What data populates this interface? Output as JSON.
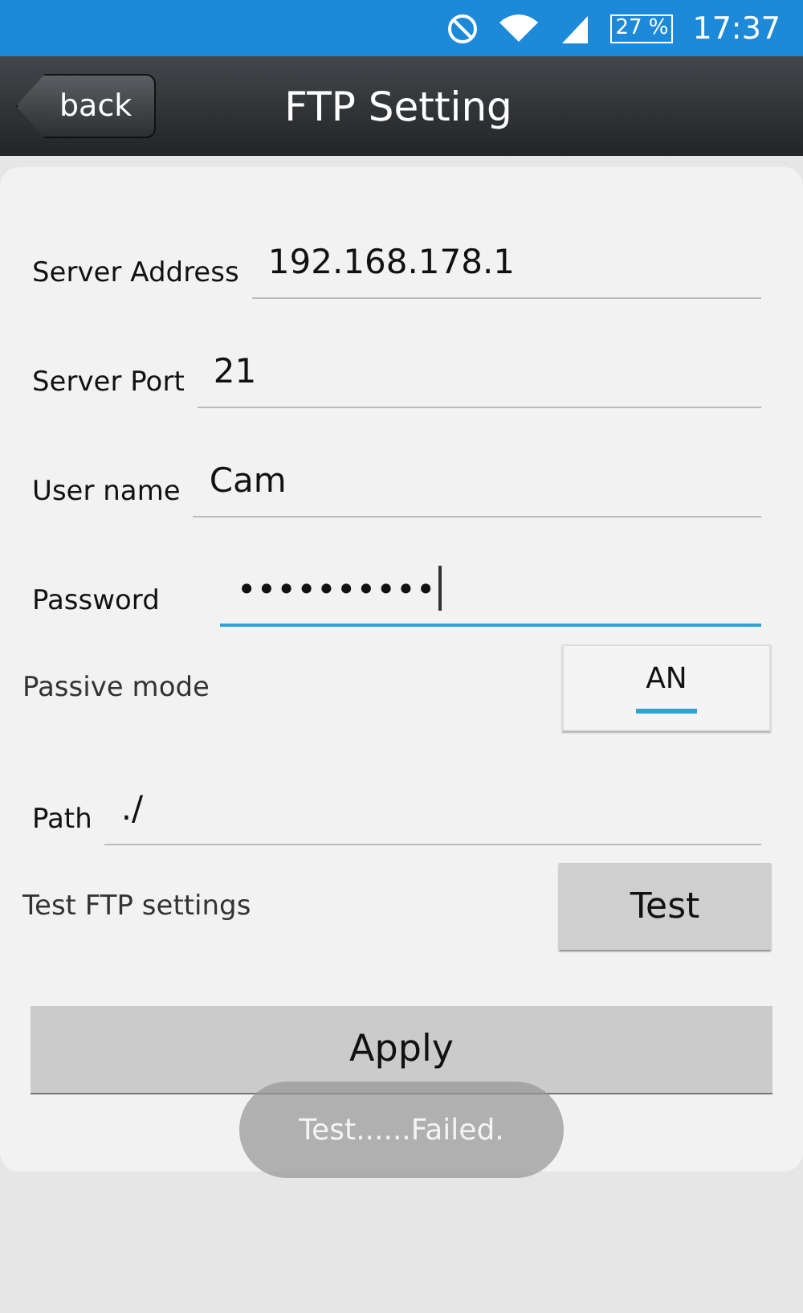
{
  "status_bar": {
    "battery": "27 %",
    "time": "17:37"
  },
  "header": {
    "back": "back",
    "title": "FTP Setting"
  },
  "fields": [
    {
      "label": "Server Address",
      "value": "192.168.178.1",
      "focused": false
    },
    {
      "label": "Server Port",
      "value": "21",
      "focused": false
    },
    {
      "label": "User name",
      "value": "Cam",
      "focused": false
    },
    {
      "label": "Password",
      "value": "••••••••••",
      "focused": true
    }
  ],
  "passive_mode": {
    "label": "Passive mode",
    "toggle": "AN",
    "on": true
  },
  "path": {
    "label": "Path",
    "value": "./",
    "focused": false
  },
  "test": {
    "label": "Test FTP settings",
    "button": "Test"
  },
  "apply": "Apply",
  "toast": "Test......Failed."
}
